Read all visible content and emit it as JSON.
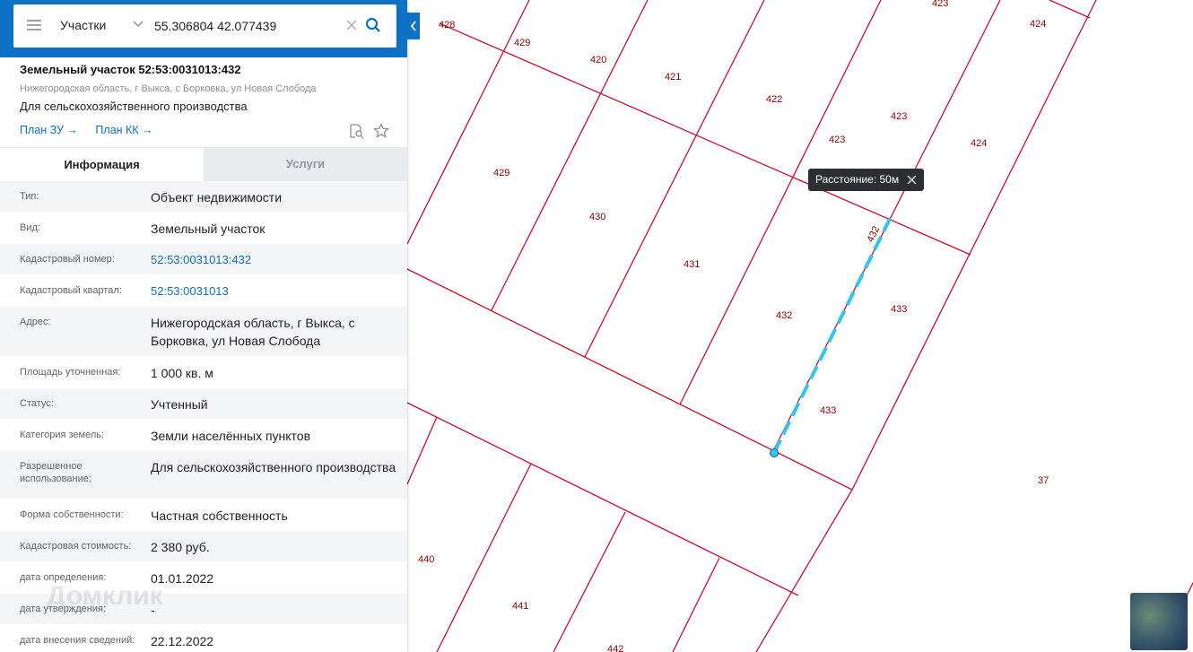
{
  "search": {
    "layer_label": "Участки",
    "query_value": "55.306804 42.077439"
  },
  "parcel": {
    "title": "Земельный участок 52:53:0031013:432",
    "address": "Нижегородская область, г Выкса, с Борковка, ул Новая Слобода",
    "purpose": "Для сельскохозяйственного производства",
    "links": [
      "План ЗУ →",
      "План КК →"
    ]
  },
  "tabs": {
    "info": "Информация",
    "services": "Услуги"
  },
  "info_rows": [
    {
      "key": "Тип:",
      "value": "Объект недвижимости"
    },
    {
      "key": "Вид:",
      "value": "Земельный участок"
    },
    {
      "key": "Кадастровый номер:",
      "value": "52:53:0031013:432"
    },
    {
      "key": "Кадастровый квартал:",
      "value": "52:53:0031013"
    },
    {
      "key": "Адрес:",
      "value": "Нижегородская область, г Выкса, с Борковка, ул Новая Слобода"
    },
    {
      "key": "Площадь уточненная:",
      "value": "1 000 кв. м"
    },
    {
      "key": "Статус:",
      "value": "Учтенный"
    },
    {
      "key": "Категория земель:",
      "value": "Земли населённых пунктов"
    },
    {
      "key": "Разрешенное использование:",
      "value": "Для сельскохозяйственного производства"
    },
    {
      "key": "Форма собственности:",
      "value": "Частная собственность"
    },
    {
      "key": "Кадастровая стоимость:",
      "value": "2 380 руб."
    },
    {
      "key": "дата определения:",
      "value": "01.01.2022"
    },
    {
      "key": "дата утверждения:",
      "value": "-"
    },
    {
      "key": "дата внесения сведений:",
      "value": "22.12.2022"
    }
  ],
  "watermark": "Домклик",
  "map": {
    "distance_tooltip": "Расстояние: 50м",
    "parcel_labels": [
      "428",
      "429",
      "420",
      "421",
      "422",
      "423",
      "424",
      "423",
      "424",
      "423",
      "429",
      "430",
      "431",
      "432",
      "432",
      "433",
      "433",
      "37",
      "440",
      "441",
      "442"
    ]
  },
  "colors": {
    "brand": "#0e72c4",
    "parcel_border": "#c8102e",
    "measure_line": "#35c3f0"
  }
}
